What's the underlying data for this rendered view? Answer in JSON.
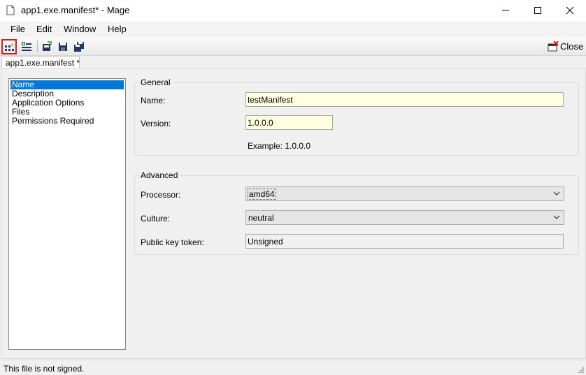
{
  "window": {
    "title": "app1.exe.manifest* - Mage"
  },
  "menu": [
    "File",
    "Edit",
    "Window",
    "Help"
  ],
  "toolbar": {
    "buttons": [
      "new-application-manifest-icon",
      "new-deployment-manifest-icon",
      "open-icon",
      "save-icon",
      "save-all-icon"
    ],
    "close_label": "Close"
  },
  "tab": {
    "label": "app1.exe.manifest *"
  },
  "nav": {
    "items": [
      "Name",
      "Description",
      "Application Options",
      "Files",
      "Permissions Required"
    ],
    "selected": "Name"
  },
  "general": {
    "title": "General",
    "name_label": "Name:",
    "name_value": "testManifest",
    "version_label": "Version:",
    "version_value": "1.0.0.0",
    "example": "Example: 1.0.0.0"
  },
  "advanced": {
    "title": "Advanced",
    "processor_label": "Processor:",
    "processor_value": "amd64",
    "culture_label": "Culture:",
    "culture_value": "neutral",
    "pkt_label": "Public key token:",
    "pkt_value": "Unsigned"
  },
  "status": {
    "text": "This file is not signed."
  },
  "colors": {
    "selection": "#0078d7",
    "highlight_border": "#e0191f",
    "required_field": "#ffffe1"
  }
}
